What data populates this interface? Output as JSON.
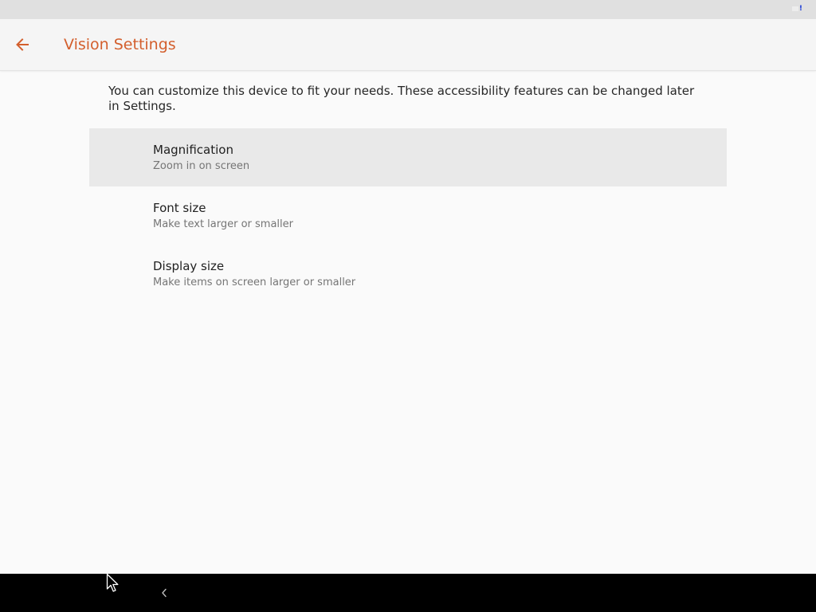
{
  "app": {
    "title": "Vision Settings",
    "accent_color": "#d35f2d"
  },
  "status_bar": {
    "indicator": "!"
  },
  "description": "You can customize this device to fit your needs. These accessibility features can be changed later in Settings.",
  "options": [
    {
      "title": "Magnification",
      "subtitle": "Zoom in on screen",
      "selected": true
    },
    {
      "title": "Font size",
      "subtitle": "Make text larger or smaller",
      "selected": false
    },
    {
      "title": "Display size",
      "subtitle": "Make items on screen larger or smaller",
      "selected": false
    }
  ],
  "icons": {
    "back": "arrow-back-icon",
    "nav_back": "chevron-left-icon",
    "cursor": "mouse-pointer-icon"
  }
}
